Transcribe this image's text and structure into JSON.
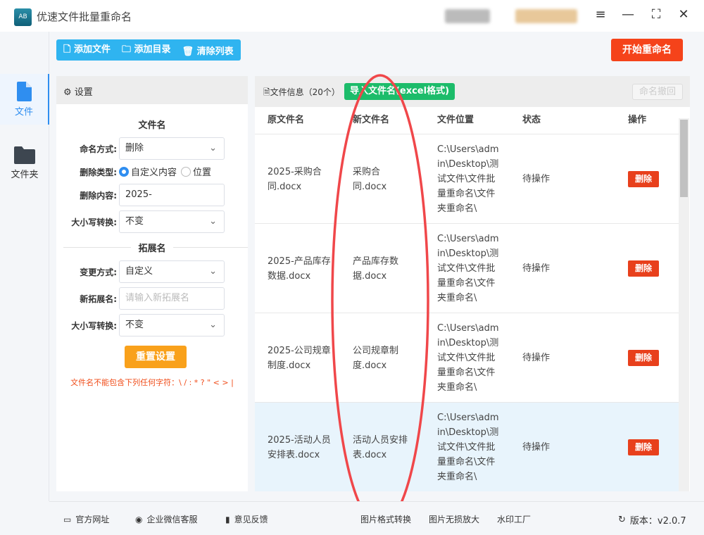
{
  "app": {
    "title": "优速文件批量重命名",
    "logo_text": "AB"
  },
  "sidebar": {
    "items": [
      {
        "label": "文件"
      },
      {
        "label": "文件夹"
      }
    ]
  },
  "toolbar": {
    "add_file": "添加文件",
    "add_dir": "添加目录",
    "clear": "清除列表",
    "start": "开始重命名"
  },
  "settings": {
    "title": "设置",
    "filename_section": "文件名",
    "naming_mode_label": "命名方式:",
    "naming_mode": "删除",
    "delete_type_label": "删除类型:",
    "delete_type_options": [
      "自定义内容",
      "位置"
    ],
    "delete_content_label": "删除内容:",
    "delete_content": "2025-",
    "case_label": "大小写转换:",
    "case_value": "不变",
    "ext_section": "拓展名",
    "change_mode_label": "变更方式:",
    "change_mode": "自定义",
    "new_ext_label": "新拓展名:",
    "new_ext_placeholder": "请输入新拓展名",
    "ext_case_label": "大小写转换:",
    "ext_case_value": "不变",
    "reset": "重置设置",
    "warning": "文件名不能包含下列任何字符：\\ / : * ? \" < > |"
  },
  "files": {
    "title": "文件信息（20个）",
    "import": "导入文件名(excel格式)",
    "undo": "命名撤回",
    "columns": [
      "原文件名",
      "新文件名",
      "文件位置",
      "状态",
      "操作"
    ],
    "rows": [
      {
        "orig": "2025-采购合同.docx",
        "new": "采购合同.docx",
        "path": "C:\\Users\\admin\\Desktop\\测试文件\\文件批量重命名\\文件夹重命名\\",
        "status": "待操作",
        "action": "删除"
      },
      {
        "orig": "2025-产品库存数据.docx",
        "new": "产品库存数据.docx",
        "path": "C:\\Users\\admin\\Desktop\\测试文件\\文件批量重命名\\文件夹重命名\\",
        "status": "待操作",
        "action": "删除"
      },
      {
        "orig": "2025-公司规章制度.docx",
        "new": "公司规章制度.docx",
        "path": "C:\\Users\\admin\\Desktop\\测试文件\\文件批量重命名\\文件夹重命名\\",
        "status": "待操作",
        "action": "删除"
      },
      {
        "orig": "2025-活动人员安排表.docx",
        "new": "活动人员安排表.docx",
        "path": "C:\\Users\\admin\\Desktop\\测试文件\\文件批量重命名\\文件夹重命名\\",
        "status": "待操作",
        "action": "删除"
      }
    ]
  },
  "footer": {
    "links": [
      "官方网址",
      "企业微信客服",
      "意见反馈",
      "图片格式转换",
      "图片无损放大",
      "水印工厂"
    ],
    "version": "版本：v2.0.7"
  }
}
